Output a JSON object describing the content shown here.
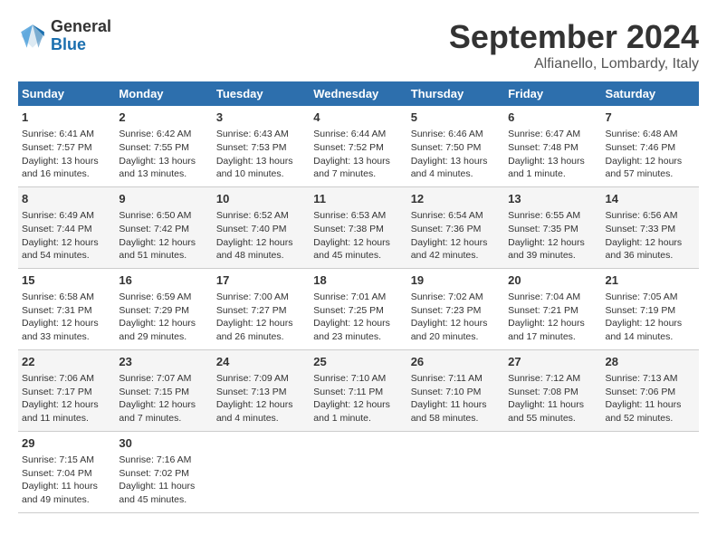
{
  "header": {
    "logo_general": "General",
    "logo_blue": "Blue",
    "month_title": "September 2024",
    "location": "Alfianello, Lombardy, Italy"
  },
  "days_of_week": [
    "Sunday",
    "Monday",
    "Tuesday",
    "Wednesday",
    "Thursday",
    "Friday",
    "Saturday"
  ],
  "weeks": [
    [
      {
        "day": "1",
        "sunrise": "Sunrise: 6:41 AM",
        "sunset": "Sunset: 7:57 PM",
        "daylight": "Daylight: 13 hours and 16 minutes."
      },
      {
        "day": "2",
        "sunrise": "Sunrise: 6:42 AM",
        "sunset": "Sunset: 7:55 PM",
        "daylight": "Daylight: 13 hours and 13 minutes."
      },
      {
        "day": "3",
        "sunrise": "Sunrise: 6:43 AM",
        "sunset": "Sunset: 7:53 PM",
        "daylight": "Daylight: 13 hours and 10 minutes."
      },
      {
        "day": "4",
        "sunrise": "Sunrise: 6:44 AM",
        "sunset": "Sunset: 7:52 PM",
        "daylight": "Daylight: 13 hours and 7 minutes."
      },
      {
        "day": "5",
        "sunrise": "Sunrise: 6:46 AM",
        "sunset": "Sunset: 7:50 PM",
        "daylight": "Daylight: 13 hours and 4 minutes."
      },
      {
        "day": "6",
        "sunrise": "Sunrise: 6:47 AM",
        "sunset": "Sunset: 7:48 PM",
        "daylight": "Daylight: 13 hours and 1 minute."
      },
      {
        "day": "7",
        "sunrise": "Sunrise: 6:48 AM",
        "sunset": "Sunset: 7:46 PM",
        "daylight": "Daylight: 12 hours and 57 minutes."
      }
    ],
    [
      {
        "day": "8",
        "sunrise": "Sunrise: 6:49 AM",
        "sunset": "Sunset: 7:44 PM",
        "daylight": "Daylight: 12 hours and 54 minutes."
      },
      {
        "day": "9",
        "sunrise": "Sunrise: 6:50 AM",
        "sunset": "Sunset: 7:42 PM",
        "daylight": "Daylight: 12 hours and 51 minutes."
      },
      {
        "day": "10",
        "sunrise": "Sunrise: 6:52 AM",
        "sunset": "Sunset: 7:40 PM",
        "daylight": "Daylight: 12 hours and 48 minutes."
      },
      {
        "day": "11",
        "sunrise": "Sunrise: 6:53 AM",
        "sunset": "Sunset: 7:38 PM",
        "daylight": "Daylight: 12 hours and 45 minutes."
      },
      {
        "day": "12",
        "sunrise": "Sunrise: 6:54 AM",
        "sunset": "Sunset: 7:36 PM",
        "daylight": "Daylight: 12 hours and 42 minutes."
      },
      {
        "day": "13",
        "sunrise": "Sunrise: 6:55 AM",
        "sunset": "Sunset: 7:35 PM",
        "daylight": "Daylight: 12 hours and 39 minutes."
      },
      {
        "day": "14",
        "sunrise": "Sunrise: 6:56 AM",
        "sunset": "Sunset: 7:33 PM",
        "daylight": "Daylight: 12 hours and 36 minutes."
      }
    ],
    [
      {
        "day": "15",
        "sunrise": "Sunrise: 6:58 AM",
        "sunset": "Sunset: 7:31 PM",
        "daylight": "Daylight: 12 hours and 33 minutes."
      },
      {
        "day": "16",
        "sunrise": "Sunrise: 6:59 AM",
        "sunset": "Sunset: 7:29 PM",
        "daylight": "Daylight: 12 hours and 29 minutes."
      },
      {
        "day": "17",
        "sunrise": "Sunrise: 7:00 AM",
        "sunset": "Sunset: 7:27 PM",
        "daylight": "Daylight: 12 hours and 26 minutes."
      },
      {
        "day": "18",
        "sunrise": "Sunrise: 7:01 AM",
        "sunset": "Sunset: 7:25 PM",
        "daylight": "Daylight: 12 hours and 23 minutes."
      },
      {
        "day": "19",
        "sunrise": "Sunrise: 7:02 AM",
        "sunset": "Sunset: 7:23 PM",
        "daylight": "Daylight: 12 hours and 20 minutes."
      },
      {
        "day": "20",
        "sunrise": "Sunrise: 7:04 AM",
        "sunset": "Sunset: 7:21 PM",
        "daylight": "Daylight: 12 hours and 17 minutes."
      },
      {
        "day": "21",
        "sunrise": "Sunrise: 7:05 AM",
        "sunset": "Sunset: 7:19 PM",
        "daylight": "Daylight: 12 hours and 14 minutes."
      }
    ],
    [
      {
        "day": "22",
        "sunrise": "Sunrise: 7:06 AM",
        "sunset": "Sunset: 7:17 PM",
        "daylight": "Daylight: 12 hours and 11 minutes."
      },
      {
        "day": "23",
        "sunrise": "Sunrise: 7:07 AM",
        "sunset": "Sunset: 7:15 PM",
        "daylight": "Daylight: 12 hours and 7 minutes."
      },
      {
        "day": "24",
        "sunrise": "Sunrise: 7:09 AM",
        "sunset": "Sunset: 7:13 PM",
        "daylight": "Daylight: 12 hours and 4 minutes."
      },
      {
        "day": "25",
        "sunrise": "Sunrise: 7:10 AM",
        "sunset": "Sunset: 7:11 PM",
        "daylight": "Daylight: 12 hours and 1 minute."
      },
      {
        "day": "26",
        "sunrise": "Sunrise: 7:11 AM",
        "sunset": "Sunset: 7:10 PM",
        "daylight": "Daylight: 11 hours and 58 minutes."
      },
      {
        "day": "27",
        "sunrise": "Sunrise: 7:12 AM",
        "sunset": "Sunset: 7:08 PM",
        "daylight": "Daylight: 11 hours and 55 minutes."
      },
      {
        "day": "28",
        "sunrise": "Sunrise: 7:13 AM",
        "sunset": "Sunset: 7:06 PM",
        "daylight": "Daylight: 11 hours and 52 minutes."
      }
    ],
    [
      {
        "day": "29",
        "sunrise": "Sunrise: 7:15 AM",
        "sunset": "Sunset: 7:04 PM",
        "daylight": "Daylight: 11 hours and 49 minutes."
      },
      {
        "day": "30",
        "sunrise": "Sunrise: 7:16 AM",
        "sunset": "Sunset: 7:02 PM",
        "daylight": "Daylight: 11 hours and 45 minutes."
      },
      null,
      null,
      null,
      null,
      null
    ]
  ]
}
